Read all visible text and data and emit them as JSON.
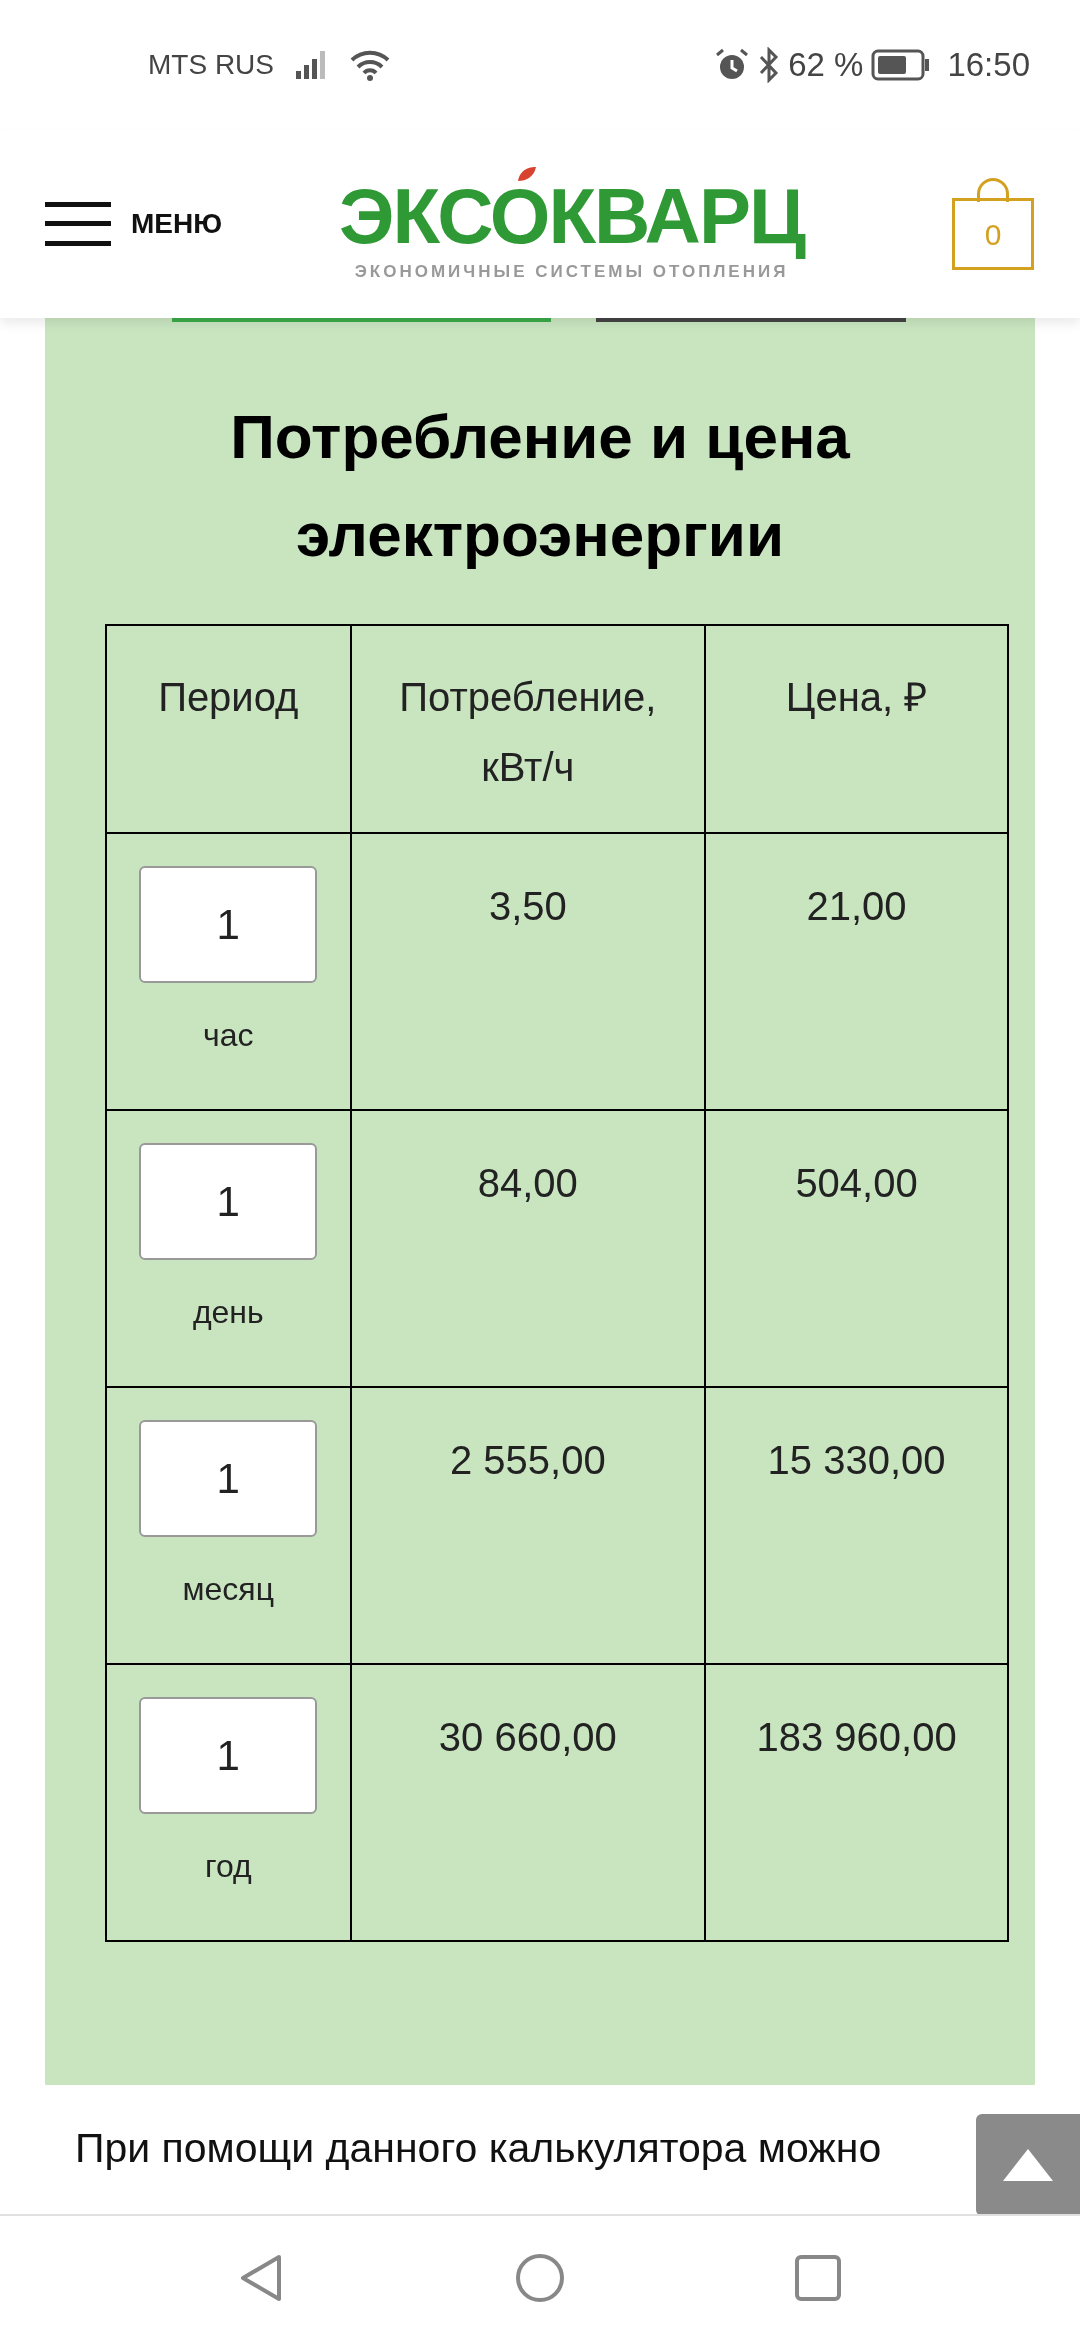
{
  "status_bar": {
    "carrier": "MTS RUS",
    "battery": "62 %",
    "time": "16:50"
  },
  "header": {
    "menu_label": "МЕНЮ",
    "logo_text": "ЭКСОКВАРЦ",
    "logo_tagline": "ЭКОНОМИЧНЫЕ СИСТЕМЫ ОТОПЛЕНИЯ",
    "cart_count": "0"
  },
  "calculator": {
    "title": "Потребление и цена электроэнергии",
    "columns": [
      "Период",
      "Потребление, кВт/ч",
      "Цена, ₽"
    ],
    "rows": [
      {
        "value": "1",
        "unit": "час",
        "consumption": "3,50",
        "price": "21,00"
      },
      {
        "value": "1",
        "unit": "день",
        "consumption": "84,00",
        "price": "504,00"
      },
      {
        "value": "1",
        "unit": "месяц",
        "consumption": "2 555,00",
        "price": "15 330,00"
      },
      {
        "value": "1",
        "unit": "год",
        "consumption": "30 660,00",
        "price": "183 960,00"
      }
    ]
  },
  "paragraph": "При помощи данного калькулятора можно"
}
